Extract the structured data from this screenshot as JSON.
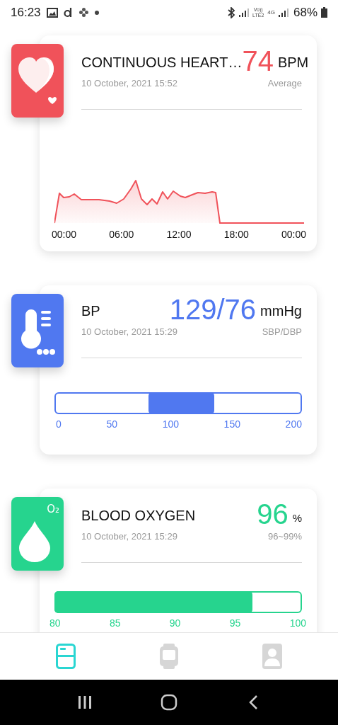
{
  "status_bar": {
    "time": "16:23",
    "network": [
      "Vo))",
      "LTE2",
      "4G"
    ],
    "battery": "68%"
  },
  "cards": [
    {
      "kind": "heart",
      "color": "#f0525a",
      "title": "CONTINUOUS HEART…",
      "date": "10 October, 2021 15:52",
      "value": "74",
      "unit": "BPM",
      "caption": "Average",
      "scale": [
        "00:00",
        "06:00",
        "12:00",
        "18:00",
        "00:00"
      ]
    },
    {
      "kind": "range",
      "color": "#5078f0",
      "title": "BP",
      "date": "10 October, 2021 15:29",
      "value": "129/76",
      "unit": "mmHg",
      "caption": "SBP/DBP",
      "scale": [
        "0",
        "50",
        "100",
        "150",
        "200"
      ]
    },
    {
      "kind": "bar",
      "color": "#26d48e",
      "badge": "O₂",
      "title": "BLOOD OXYGEN",
      "date": "10 October, 2021 15:29",
      "value": "96",
      "unit": "%",
      "caption": "96~99%",
      "scale": [
        "80",
        "85",
        "90",
        "95",
        "100"
      ],
      "level": 0.8
    }
  ],
  "nav_tabs": [
    {
      "kind": "cards",
      "selected": true
    },
    {
      "kind": "watch",
      "selected": false
    },
    {
      "kind": "profile",
      "selected": false
    }
  ]
}
